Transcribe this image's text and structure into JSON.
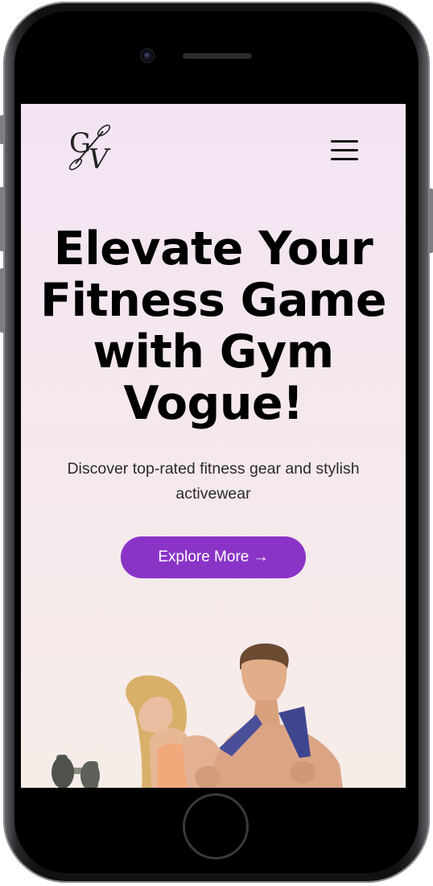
{
  "brand": {
    "logo_text": "GV"
  },
  "header": {
    "menu_label": "Menu"
  },
  "hero": {
    "title": "Elevate Your Fitness Game with Gym Vogue!",
    "subtitle": "Discover top-rated fitness gear and stylish activewear",
    "cta_label": "Explore More →"
  },
  "colors": {
    "accent": "#8a34c7",
    "background_top": "#f3e4f4",
    "background_bottom": "#f6ede8"
  },
  "icons": {
    "menu": "hamburger-icon",
    "logo": "gv-logo"
  }
}
